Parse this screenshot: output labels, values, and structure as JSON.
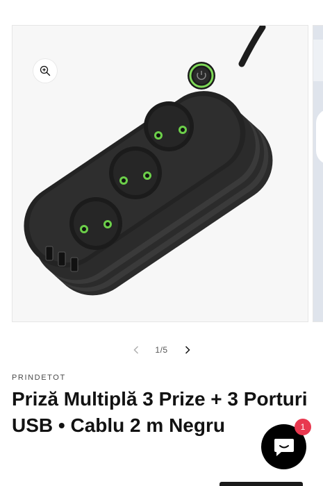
{
  "gallery": {
    "current": 1,
    "total": 5,
    "counter_text": "1/5",
    "images": [
      {
        "alt_visible": false,
        "icon": "power-strip"
      }
    ]
  },
  "product": {
    "vendor": "PRINDETOT",
    "title": "Priză Multiplă 3 Prize + 3 Porturi USB • Cablu 2 m Negru"
  },
  "chat": {
    "badge_count": "1",
    "icon": "chat-bubble-icon"
  },
  "colors": {
    "background": "#ffffff",
    "badge": "#e8384f",
    "chat_button": "#000000",
    "power_ring": "#7ed957"
  }
}
